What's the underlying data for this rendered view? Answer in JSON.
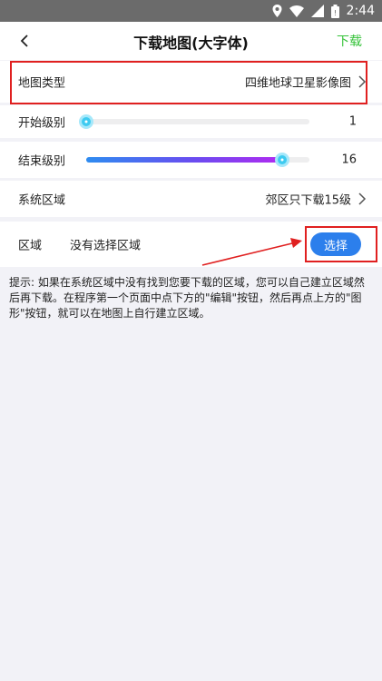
{
  "status_bar": {
    "time": "2:44",
    "icons": [
      "location-icon",
      "wifi-icon",
      "signal-icon",
      "battery-icon"
    ]
  },
  "app_bar": {
    "title": "下载地图(大字体)",
    "back_icon": "chevron-left-icon",
    "action_label": "下载",
    "action_color": "#36c23a"
  },
  "settings": {
    "map_type": {
      "label": "地图类型",
      "value": "四维地球卫星影像图"
    },
    "start_level": {
      "label": "开始级别",
      "value": "1",
      "fraction": 0.0
    },
    "end_level": {
      "label": "结束级别",
      "value": "16",
      "fraction": 0.88
    },
    "system_area": {
      "label": "系统区域",
      "value": "郊区只下载15级"
    },
    "area": {
      "label": "区域",
      "value": "没有选择区域",
      "button_label": "选择"
    }
  },
  "hint": "提示: 如果在系统区域中没有找到您要下载的区域，您可以自己建立区域然后再下载。在程序第一个页面中点下方的\"编辑\"按钮，然后再点上方的\"图形\"按钮，就可以在地图上自行建立区域。",
  "colors": {
    "accent_blue": "#2c7fec",
    "highlight_red": "#e02020",
    "slider_gradient_start": "#2e8cf0",
    "slider_gradient_end": "#b12af0",
    "thumb": "#3ecbf1"
  }
}
